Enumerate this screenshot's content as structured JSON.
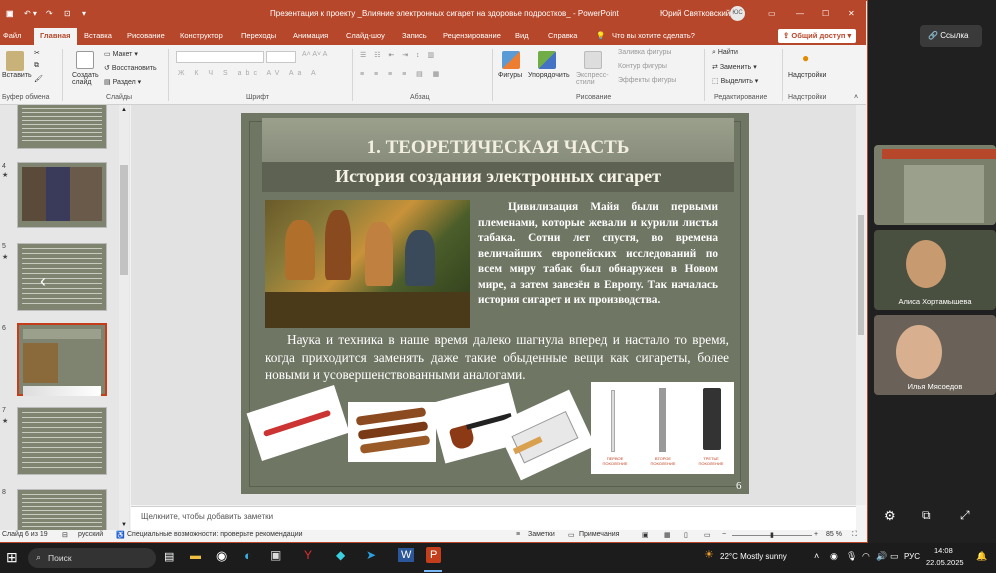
{
  "window": {
    "title": "Презентация к проекту _Влияние электронных сигарет на здоровье подростков_ - PowerPoint",
    "user": "Юрий Святковский",
    "user_initials": "ЮС"
  },
  "tabs": [
    "Файл",
    "Главная",
    "Вставка",
    "Рисование",
    "Конструктор",
    "Переходы",
    "Анимация",
    "Слайд-шоу",
    "Запись",
    "Рецензирование",
    "Вид",
    "Справка"
  ],
  "tell_me": "Что вы хотите сделать?",
  "share_label": "Общий доступ",
  "ribbon": {
    "paste": "Вставить",
    "clipboard_group": "Буфер обмена",
    "new_slide": "Создать слайд",
    "layout": "Макет",
    "reset": "Восстановить",
    "section": "Раздел",
    "slides_group": "Слайды",
    "font_group": "Шрифт",
    "paragraph_group": "Абзац",
    "shapes": "Фигуры",
    "arrange": "Упорядочить",
    "quick_styles": "Экспресс-стили",
    "shape_fill": "Заливка фигуры",
    "shape_outline": "Контур фигуры",
    "shape_effects": "Эффекты фигуры",
    "drawing_group": "Рисование",
    "find": "Найти",
    "replace": "Заменить",
    "select": "Выделить",
    "editing_group": "Редактирование",
    "addins": "Надстройки",
    "addins_group": "Надстройки"
  },
  "thumbnails": [
    {
      "number": "",
      "selected": false
    },
    {
      "number": "4",
      "selected": false
    },
    {
      "number": "5",
      "selected": false
    },
    {
      "number": "6",
      "selected": true
    },
    {
      "number": "7",
      "selected": false
    },
    {
      "number": "8",
      "selected": false
    }
  ],
  "slide": {
    "title": "1. ТЕОРЕТИЧЕСКАЯ ЧАСТЬ",
    "subtitle": "История создания электронных сигарет",
    "paragraph1": "Цивилизация Майя были первыми племенами, которые жевали и курили листья табака. Сотни лет спустя, во времена величайших европейских исследований по всем миру табак был обнаружен в Новом мире, а затем завезён в Европу. Так началась история сигарет и их производства.",
    "paragraph2": "Наука и техника в наше время далеко шагнула вперед и настало то время, когда приходится заменять даже такие обыденные вещи как сигареты, более новыми и усовершенствованными аналогами.",
    "gen_labels": [
      "ПЕРВОЕ ПОКОЛЕНИЕ",
      "ВТОРОЕ ПОКОЛЕНИЕ",
      "ТРЕТЬЕ ПОКОЛЕНИЕ"
    ],
    "number": "6"
  },
  "notes_placeholder": "Щелкните, чтобы добавить заметки",
  "status": {
    "slide_info": "Слайд 6 из 19",
    "language": "русский",
    "accessibility": "Специальные возможности: проверьте рекомендации",
    "notes_btn": "Заметки",
    "comments_btn": "Примечания",
    "zoom": "85 %"
  },
  "meeting": {
    "link_button": "Ссылка",
    "participants": [
      {
        "name": "Алиса Хортамышева"
      },
      {
        "name": "Илья Мясоедов"
      }
    ]
  },
  "taskbar": {
    "search": "Поиск",
    "weather": "22°C  Mostly sunny",
    "lang": "РУС",
    "time": "14:08",
    "date": "22.05.2025"
  }
}
